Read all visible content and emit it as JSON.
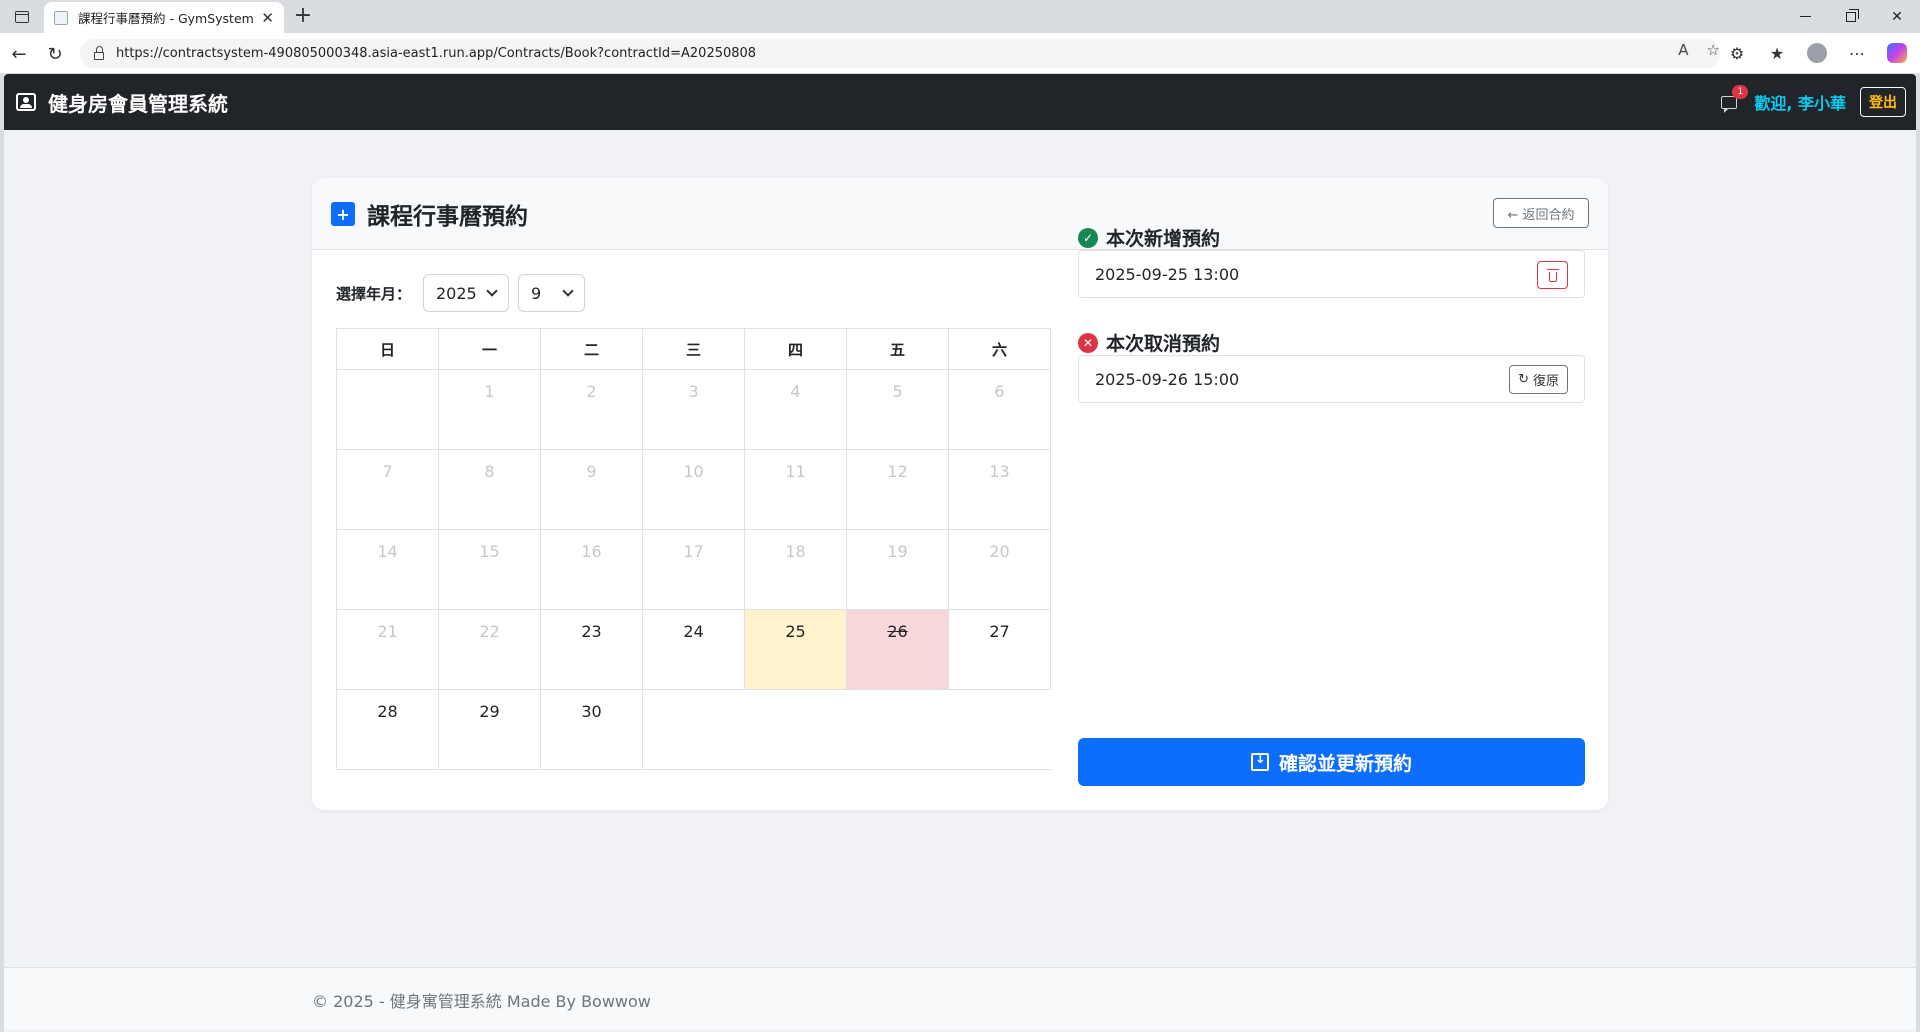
{
  "browser": {
    "tab_title": "課程行事曆預約 - GymSystem",
    "url": "https://contractsystem-490805000348.asia-east1.run.app/Contracts/Book?contractId=A20250808"
  },
  "app": {
    "brand": "健身房會員管理系統",
    "message_count": "1",
    "welcome": "歡迎, 李小華",
    "logout": "登出"
  },
  "page": {
    "title": "課程行事曆預約",
    "back_button": "← 返回合約",
    "year_month_label": "選擇年月：",
    "selected_year": "2025",
    "selected_month": "9"
  },
  "calendar": {
    "weekdays": [
      "日",
      "一",
      "二",
      "三",
      "四",
      "五",
      "六"
    ],
    "weeks": [
      [
        {
          "d": "",
          "s": "empty-first"
        },
        {
          "d": "1",
          "s": "past"
        },
        {
          "d": "2",
          "s": "past"
        },
        {
          "d": "3",
          "s": "past"
        },
        {
          "d": "4",
          "s": "past"
        },
        {
          "d": "5",
          "s": "past"
        },
        {
          "d": "6",
          "s": "past"
        }
      ],
      [
        {
          "d": "7",
          "s": "past"
        },
        {
          "d": "8",
          "s": "past"
        },
        {
          "d": "9",
          "s": "past"
        },
        {
          "d": "10",
          "s": "past"
        },
        {
          "d": "11",
          "s": "past"
        },
        {
          "d": "12",
          "s": "past"
        },
        {
          "d": "13",
          "s": "past"
        }
      ],
      [
        {
          "d": "14",
          "s": "past"
        },
        {
          "d": "15",
          "s": "past"
        },
        {
          "d": "16",
          "s": "past"
        },
        {
          "d": "17",
          "s": "past"
        },
        {
          "d": "18",
          "s": "past"
        },
        {
          "d": "19",
          "s": "past"
        },
        {
          "d": "20",
          "s": "past"
        }
      ],
      [
        {
          "d": "21",
          "s": "past"
        },
        {
          "d": "22",
          "s": "past"
        },
        {
          "d": "23",
          "s": "open"
        },
        {
          "d": "24",
          "s": "open"
        },
        {
          "d": "25",
          "s": "added"
        },
        {
          "d": "26",
          "s": "cancelled"
        },
        {
          "d": "27",
          "s": "open"
        }
      ],
      [
        {
          "d": "28",
          "s": "open"
        },
        {
          "d": "29",
          "s": "open"
        },
        {
          "d": "30",
          "s": "open"
        },
        {
          "d": "",
          "s": "empty"
        },
        {
          "d": "",
          "s": "empty"
        },
        {
          "d": "",
          "s": "empty"
        },
        {
          "d": "",
          "s": "empty"
        }
      ]
    ]
  },
  "new_bookings": {
    "title": "本次新增預約",
    "items": [
      "2025-09-25 13:00"
    ]
  },
  "cancelled_bookings": {
    "title": "本次取消預約",
    "items": [
      "2025-09-26 15:00"
    ],
    "restore_label": "復原"
  },
  "confirm_button": "確認並更新預約",
  "footer": "© 2025 - 健身寓管理系統 Made By Bowwow",
  "colors": {
    "navbar": "#212529",
    "primary": "#0d6efd",
    "added_day": "#fff3cd",
    "cancelled_day": "#f8d7da",
    "welcome": "#0dcaf0",
    "logout": "#ffc107"
  }
}
